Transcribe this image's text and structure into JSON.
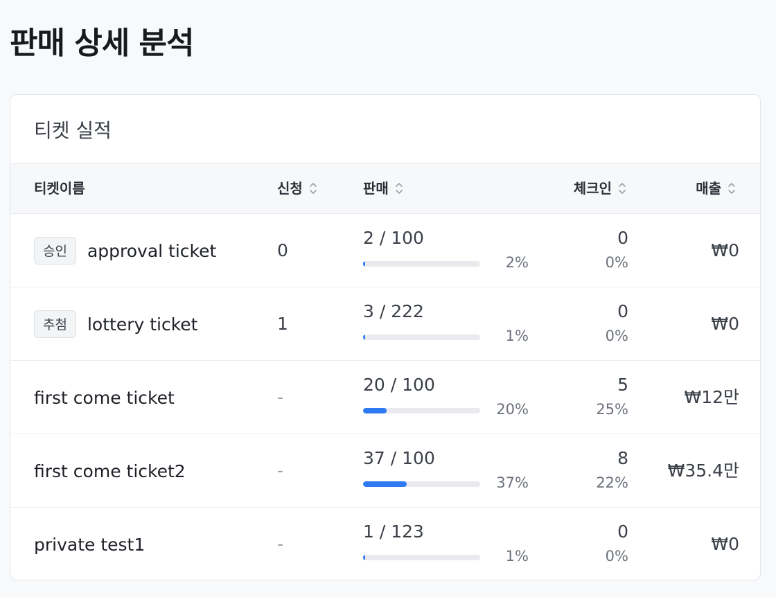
{
  "page": {
    "title": "판매 상세 분석"
  },
  "card": {
    "title": "티켓 실적"
  },
  "table": {
    "headers": {
      "name": "티켓이름",
      "apply": "신청",
      "sales": "판매",
      "checkin": "체크인",
      "revenue": "매출"
    },
    "rows": [
      {
        "badge": "승인",
        "name": "approval ticket",
        "apply": "0",
        "sales": "2 / 100",
        "sales_pct": "2%",
        "sales_ratio": 0.02,
        "checkin": "0",
        "checkin_pct": "0%",
        "revenue": "₩0"
      },
      {
        "badge": "추첨",
        "name": "lottery ticket",
        "apply": "1",
        "sales": "3 / 222",
        "sales_pct": "1%",
        "sales_ratio": 0.014,
        "checkin": "0",
        "checkin_pct": "0%",
        "revenue": "₩0"
      },
      {
        "name": "first come ticket",
        "apply": "-",
        "sales": "20 / 100",
        "sales_pct": "20%",
        "sales_ratio": 0.2,
        "checkin": "5",
        "checkin_pct": "25%",
        "revenue": "₩12만"
      },
      {
        "name": "first come ticket2",
        "apply": "-",
        "sales": "37 / 100",
        "sales_pct": "37%",
        "sales_ratio": 0.37,
        "checkin": "8",
        "checkin_pct": "22%",
        "revenue": "₩35.4만"
      },
      {
        "name": "private test1",
        "apply": "-",
        "sales": "1 / 123",
        "sales_pct": "1%",
        "sales_ratio": 0.008,
        "checkin": "0",
        "checkin_pct": "0%",
        "revenue": "₩0"
      }
    ]
  },
  "colors": {
    "accent": "#2f7af3",
    "track": "#e9eaee"
  },
  "icons": {
    "sort": "sort-updown-icon"
  }
}
